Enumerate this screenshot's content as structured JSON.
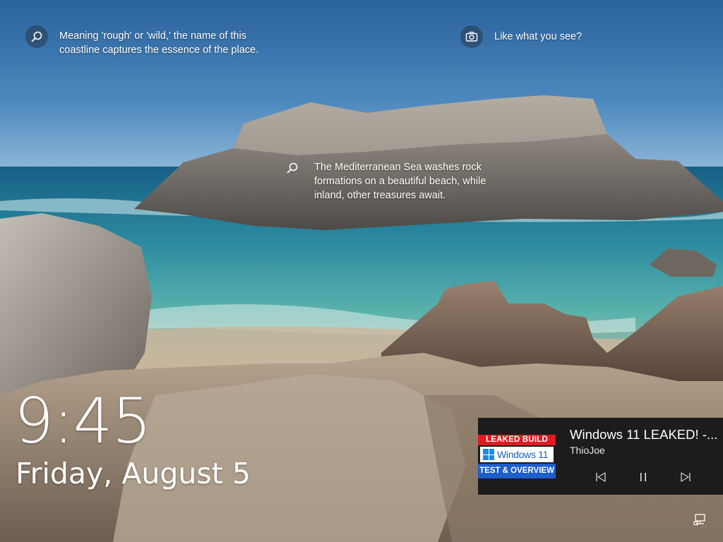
{
  "lockscreen": {
    "hotspots": [
      {
        "icon": "search-icon",
        "text": "Meaning 'rough' or 'wild,' the name of this coastline captures the essence of the place."
      },
      {
        "icon": "camera-icon",
        "text": "Like what you see?"
      },
      {
        "icon": "search-icon",
        "text": "The Mediterranean Sea washes rock formations on a beautiful beach, while inland, other treasures await."
      }
    ],
    "clock": {
      "time": "9:45",
      "date": "Friday, August 5"
    },
    "media": {
      "title": "Windows 11 LEAKED! -...",
      "artist": "ThioJoe",
      "thumbnail": {
        "line1": "LEAKED BUILD",
        "line2": "Windows 11",
        "line3": "TEST & OVERVIEW"
      },
      "controls": {
        "previous": "previous-track-icon",
        "pause": "pause-icon",
        "next": "next-track-icon"
      }
    },
    "tray": {
      "network": "network-icon"
    },
    "colors": {
      "sky_top": "#2f6aa6",
      "sea": "#2f8fa6",
      "rock": "#7d7670",
      "media_card_bg": "#141416",
      "thumb_red": "#e01b22",
      "thumb_blue": "#1d5ec9"
    }
  }
}
